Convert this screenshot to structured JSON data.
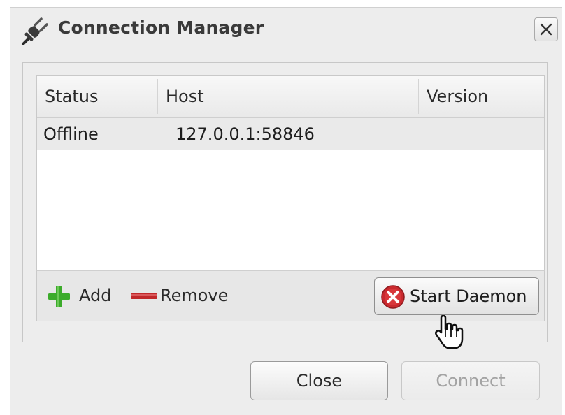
{
  "window": {
    "title": "Connection Manager",
    "title_icon": "plug-icon",
    "close_icon": "close-icon"
  },
  "connections": {
    "columns": [
      "Status",
      "Host",
      "Version"
    ],
    "rows": [
      {
        "status": "Offline",
        "host": "127.0.0.1:58846",
        "version": ""
      }
    ]
  },
  "toolbar": {
    "add_label": "Add",
    "add_icon": "plus-icon",
    "remove_label": "Remove",
    "remove_icon": "minus-icon",
    "start_daemon_label": "Start Daemon",
    "start_daemon_icon": "stop-circle-icon"
  },
  "buttons": {
    "close_label": "Close",
    "connect_label": "Connect",
    "connect_enabled": false
  },
  "colors": {
    "add_green": "#3cab2b",
    "remove_red": "#c0282a",
    "daemon_red": "#c9292e",
    "selected_row": "#eaeaea"
  }
}
